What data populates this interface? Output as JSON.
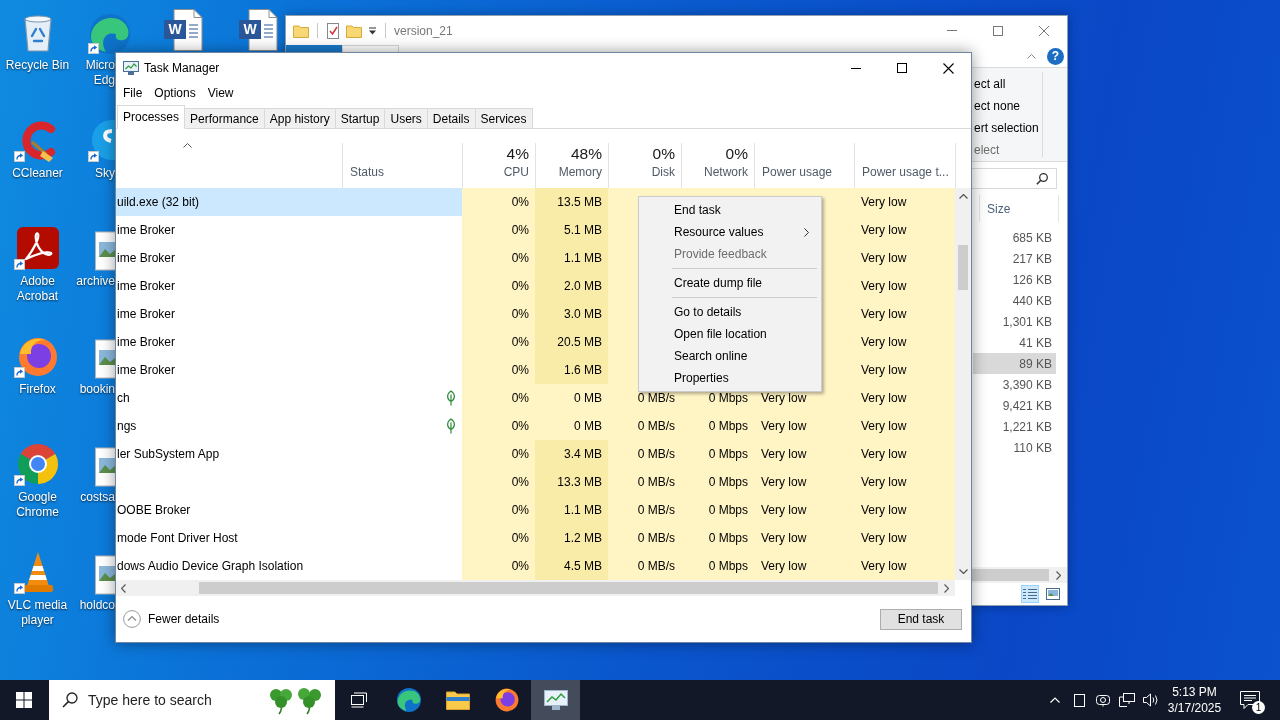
{
  "desktop": {
    "columns": [
      [
        {
          "kind": "recycle-bin",
          "label": "Recycle Bin",
          "shortcut": false
        },
        {
          "kind": "ccleaner",
          "label": "CCleaner",
          "shortcut": true
        },
        {
          "kind": "acrobat",
          "label": "Adobe Acrobat",
          "shortcut": true
        },
        {
          "kind": "firefox",
          "label": "Firefox",
          "shortcut": true
        },
        {
          "kind": "chrome",
          "label": "Google Chrome",
          "shortcut": true
        },
        {
          "kind": "vlc",
          "label": "VLC media player",
          "shortcut": true
        }
      ],
      [
        {
          "kind": "edge",
          "label": "Micro Edg",
          "shortcut": true
        },
        {
          "kind": "skype",
          "label": "Sky",
          "shortcut": true
        },
        {
          "kind": "image-file",
          "label": "archive",
          "shortcut": false
        },
        {
          "kind": "image-file",
          "label": "bookin",
          "shortcut": false
        },
        {
          "kind": "image-file",
          "label": "costsa",
          "shortcut": false
        },
        {
          "kind": "image-file",
          "label": "holdco",
          "shortcut": false
        }
      ],
      [
        {
          "kind": "word-file",
          "badge": "W",
          "shortcut": false
        }
      ],
      [
        {
          "kind": "word-file",
          "badge": "W",
          "shortcut": false
        }
      ]
    ]
  },
  "explorer": {
    "title": "version_21",
    "ribbon_tabs": [
      {
        "kind": "file",
        "selected": false
      },
      {
        "kind": "tab",
        "selected": true
      }
    ],
    "help": "?",
    "ribbon_commands": [
      "ect all",
      "ect none",
      "ert selection"
    ],
    "ribbon_group": "elect",
    "columns": [
      "Size"
    ],
    "files": [
      {
        "size": "685 KB",
        "selected": false
      },
      {
        "size": "217 KB",
        "selected": false
      },
      {
        "size": "126 KB",
        "selected": false
      },
      {
        "size": "440 KB",
        "selected": false
      },
      {
        "size": "1,301 KB",
        "selected": false
      },
      {
        "size": "41 KB",
        "selected": false
      },
      {
        "size": "89 KB",
        "selected": true
      },
      {
        "size": "3,390 KB",
        "selected": false
      },
      {
        "size": "9,421 KB",
        "selected": false
      },
      {
        "size": "1,221 KB",
        "selected": false
      },
      {
        "size": "110 KB",
        "selected": false
      }
    ],
    "views": [
      {
        "kind": "details",
        "selected": true
      },
      {
        "kind": "large-icons",
        "selected": false
      }
    ]
  },
  "task_manager": {
    "title": "Task Manager",
    "menu": [
      "File",
      "Options",
      "View"
    ],
    "tabs": [
      {
        "label": "Processes",
        "selected": true
      },
      {
        "label": "Performance",
        "selected": false
      },
      {
        "label": "App history",
        "selected": false
      },
      {
        "label": "Startup",
        "selected": false
      },
      {
        "label": "Users",
        "selected": false
      },
      {
        "label": "Details",
        "selected": false
      },
      {
        "label": "Services",
        "selected": false
      }
    ],
    "columns": [
      {
        "kind": "plain",
        "sorted": true
      },
      {
        "kind": "plain",
        "label": "Status",
        "sorted": false
      },
      {
        "kind": "metric",
        "percent": "4%",
        "label": "CPU",
        "sorted": false
      },
      {
        "kind": "metric",
        "percent": "48%",
        "label": "Memory",
        "sorted": false
      },
      {
        "kind": "metric",
        "percent": "0%",
        "label": "Disk",
        "sorted": false
      },
      {
        "kind": "metric",
        "percent": "0%",
        "label": "Network",
        "sorted": false
      },
      {
        "kind": "plain",
        "label": "Power usage",
        "sorted": false
      },
      {
        "kind": "plain",
        "label": "Power usage t...",
        "sorted": false
      }
    ],
    "rows": [
      {
        "name": "uild.exe (32 bit)",
        "selected": true,
        "suspended": false,
        "cpu": "0%",
        "memory": {
          "value": "13.5 MB",
          "color": "#f9eca8"
        },
        "column_8": "Very low"
      },
      {
        "name": "ime Broker",
        "selected": false,
        "suspended": false,
        "cpu": "0%",
        "memory": {
          "value": "5.1 MB",
          "color": "#f9eca8"
        },
        "column_8": "Very low"
      },
      {
        "name": "ime Broker",
        "selected": false,
        "suspended": false,
        "cpu": "0%",
        "memory": {
          "value": "1.1 MB",
          "color": "#f9eca8"
        },
        "column_8": "Very low"
      },
      {
        "name": "ime Broker",
        "selected": false,
        "suspended": false,
        "cpu": "0%",
        "memory": {
          "value": "2.0 MB",
          "color": "#f9eca8"
        },
        "column_8": "Very low"
      },
      {
        "name": "ime Broker",
        "selected": false,
        "suspended": false,
        "cpu": "0%",
        "memory": {
          "value": "3.0 MB",
          "color": "#f9eca8"
        },
        "column_8": "Very low"
      },
      {
        "name": "ime Broker",
        "selected": false,
        "suspended": false,
        "cpu": "0%",
        "memory": {
          "value": "20.5 MB",
          "color": "#f9eca8"
        },
        "column_8": "Very low"
      },
      {
        "name": "ime Broker",
        "selected": false,
        "suspended": false,
        "cpu": "0%",
        "memory": {
          "value": "1.6 MB",
          "color": "#f9eca8"
        },
        "column_8": "Very low"
      },
      {
        "name": "ch",
        "selected": false,
        "suspended": true,
        "cpu": "0%",
        "memory": {
          "value": "0 MB",
          "color": "#fff4c4"
        },
        "disk": "0 MB/s",
        "network": "0 Mbps",
        "power_usage": "Very low",
        "column_8": "Very low"
      },
      {
        "name": "ngs",
        "selected": false,
        "suspended": true,
        "cpu": "0%",
        "memory": {
          "value": "0 MB",
          "color": "#fff4c4"
        },
        "disk": "0 MB/s",
        "network": "0 Mbps",
        "power_usage": "Very low",
        "column_8": "Very low"
      },
      {
        "name": "ler SubSystem App",
        "selected": false,
        "suspended": false,
        "cpu": "0%",
        "memory": {
          "value": "3.4 MB",
          "color": "#f9eca8"
        },
        "disk": "0 MB/s",
        "network": "0 Mbps",
        "power_usage": "Very low",
        "column_8": "Very low"
      },
      {
        "selected": false,
        "suspended": false,
        "cpu": "0%",
        "memory": {
          "value": "13.3 MB",
          "color": "#f9eca8"
        },
        "disk": "0 MB/s",
        "network": "0 Mbps",
        "power_usage": "Very low",
        "column_8": "Very low"
      },
      {
        "name": "OOBE Broker",
        "selected": false,
        "suspended": false,
        "cpu": "0%",
        "memory": {
          "value": "1.1 MB",
          "color": "#f9eca8"
        },
        "disk": "0 MB/s",
        "network": "0 Mbps",
        "power_usage": "Very low",
        "column_8": "Very low"
      },
      {
        "name": "mode Font Driver Host",
        "selected": false,
        "suspended": false,
        "cpu": "0%",
        "memory": {
          "value": "1.2 MB",
          "color": "#f9eca8"
        },
        "disk": "0 MB/s",
        "network": "0 Mbps",
        "power_usage": "Very low",
        "column_8": "Very low"
      },
      {
        "name": "dows Audio Device Graph Isolation",
        "selected": false,
        "suspended": false,
        "cpu": "0%",
        "memory": {
          "value": "4.5 MB",
          "color": "#f9eca8"
        },
        "disk": "0 MB/s",
        "network": "0 Mbps",
        "power_usage": "Very low",
        "column_8": "Very low"
      }
    ],
    "context_menu": [
      {
        "kind": "item",
        "label": "End task",
        "disabled": false,
        "submenu": false
      },
      {
        "kind": "item",
        "label": "Resource values",
        "disabled": false,
        "submenu": true
      },
      {
        "kind": "item",
        "label": "Provide feedback",
        "disabled": true,
        "submenu": false
      },
      {
        "kind": "separator"
      },
      {
        "kind": "item",
        "label": "Create dump file",
        "disabled": false,
        "submenu": false
      },
      {
        "kind": "separator"
      },
      {
        "kind": "item",
        "label": "Go to details",
        "disabled": false,
        "submenu": false
      },
      {
        "kind": "item",
        "label": "Open file location",
        "disabled": false,
        "submenu": false
      },
      {
        "kind": "item",
        "label": "Search online",
        "disabled": false,
        "submenu": false
      },
      {
        "kind": "item",
        "label": "Properties",
        "disabled": false,
        "submenu": false
      }
    ],
    "footer": {
      "fewer_details": "Fewer details",
      "end_task": "End task"
    }
  },
  "taskbar": {
    "search": {
      "placeholder": "Type here to search"
    },
    "apps": [
      {
        "kind": "task-view",
        "active": false
      },
      {
        "kind": "edge",
        "active": false
      },
      {
        "kind": "file-explorer",
        "active": false
      },
      {
        "kind": "firefox",
        "active": false
      },
      {
        "kind": "task-manager",
        "active": true
      }
    ],
    "time": "5:13 PM",
    "date": "3/17/2025",
    "notifications": "1"
  }
}
